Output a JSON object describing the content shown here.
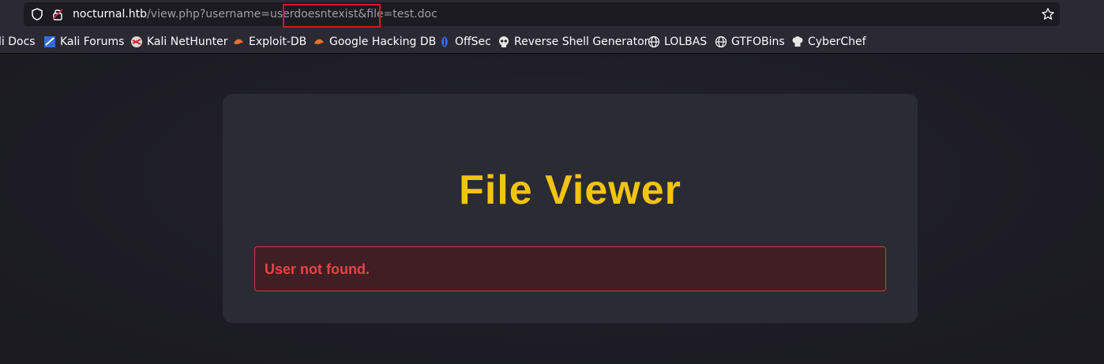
{
  "browser": {
    "url_host": "nocturnal.htb",
    "url_path_before": "/view.php?username=",
    "url_highlighted": "userdoesntexist",
    "url_path_after": "&file=test.doc",
    "highlight_color": "#e3121c"
  },
  "bookmarks": [
    {
      "label": "li Docs",
      "icon": "kali-docs-icon"
    },
    {
      "label": "Kali Forums",
      "icon": "kali-forums-icon"
    },
    {
      "label": "Kali NetHunter",
      "icon": "kali-nethunter-icon"
    },
    {
      "label": "Exploit-DB",
      "icon": "exploit-db-icon"
    },
    {
      "label": "Google Hacking DB",
      "icon": "ghdb-icon"
    },
    {
      "label": "OffSec",
      "icon": "offsec-icon"
    },
    {
      "label": "Reverse Shell Generator",
      "icon": "skull-icon"
    },
    {
      "label": "LOLBAS",
      "icon": "globe-icon"
    },
    {
      "label": "GTFOBins",
      "icon": "globe-icon"
    },
    {
      "label": "CyberChef",
      "icon": "chef-hat-icon"
    }
  ],
  "page": {
    "title": "File Viewer",
    "error_message": "User not found.",
    "accent_color": "#f1c40f",
    "error_color": "#e54545"
  }
}
